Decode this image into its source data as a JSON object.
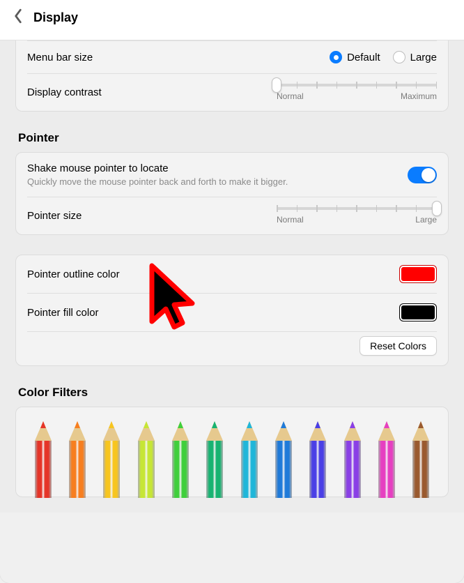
{
  "header": {
    "title": "Display"
  },
  "menu_bar_size": {
    "label": "Menu bar size",
    "options": {
      "default": "Default",
      "large": "Large"
    },
    "selected": "default"
  },
  "display_contrast": {
    "label": "Display contrast",
    "min_label": "Normal",
    "max_label": "Maximum",
    "value_pct": 0
  },
  "pointer_section": {
    "title": "Pointer",
    "shake": {
      "label": "Shake mouse pointer to locate",
      "desc": "Quickly move the mouse pointer back and forth to make it bigger.",
      "enabled": true
    },
    "size": {
      "label": "Pointer size",
      "min_label": "Normal",
      "max_label": "Large",
      "value_pct": 100
    },
    "outline": {
      "label": "Pointer outline color",
      "color": "#ff0000"
    },
    "fill": {
      "label": "Pointer fill color",
      "color": "#000000"
    },
    "reset_label": "Reset Colors"
  },
  "color_filters": {
    "title": "Color Filters",
    "pencil_colors": [
      "#e53528",
      "#f77e1f",
      "#f7c51f",
      "#c6e635",
      "#3fcf3b",
      "#17b371",
      "#1fb6d9",
      "#1f7ad9",
      "#4a3fe6",
      "#8a3fe6",
      "#e63fc1",
      "#9a5a2f"
    ]
  }
}
